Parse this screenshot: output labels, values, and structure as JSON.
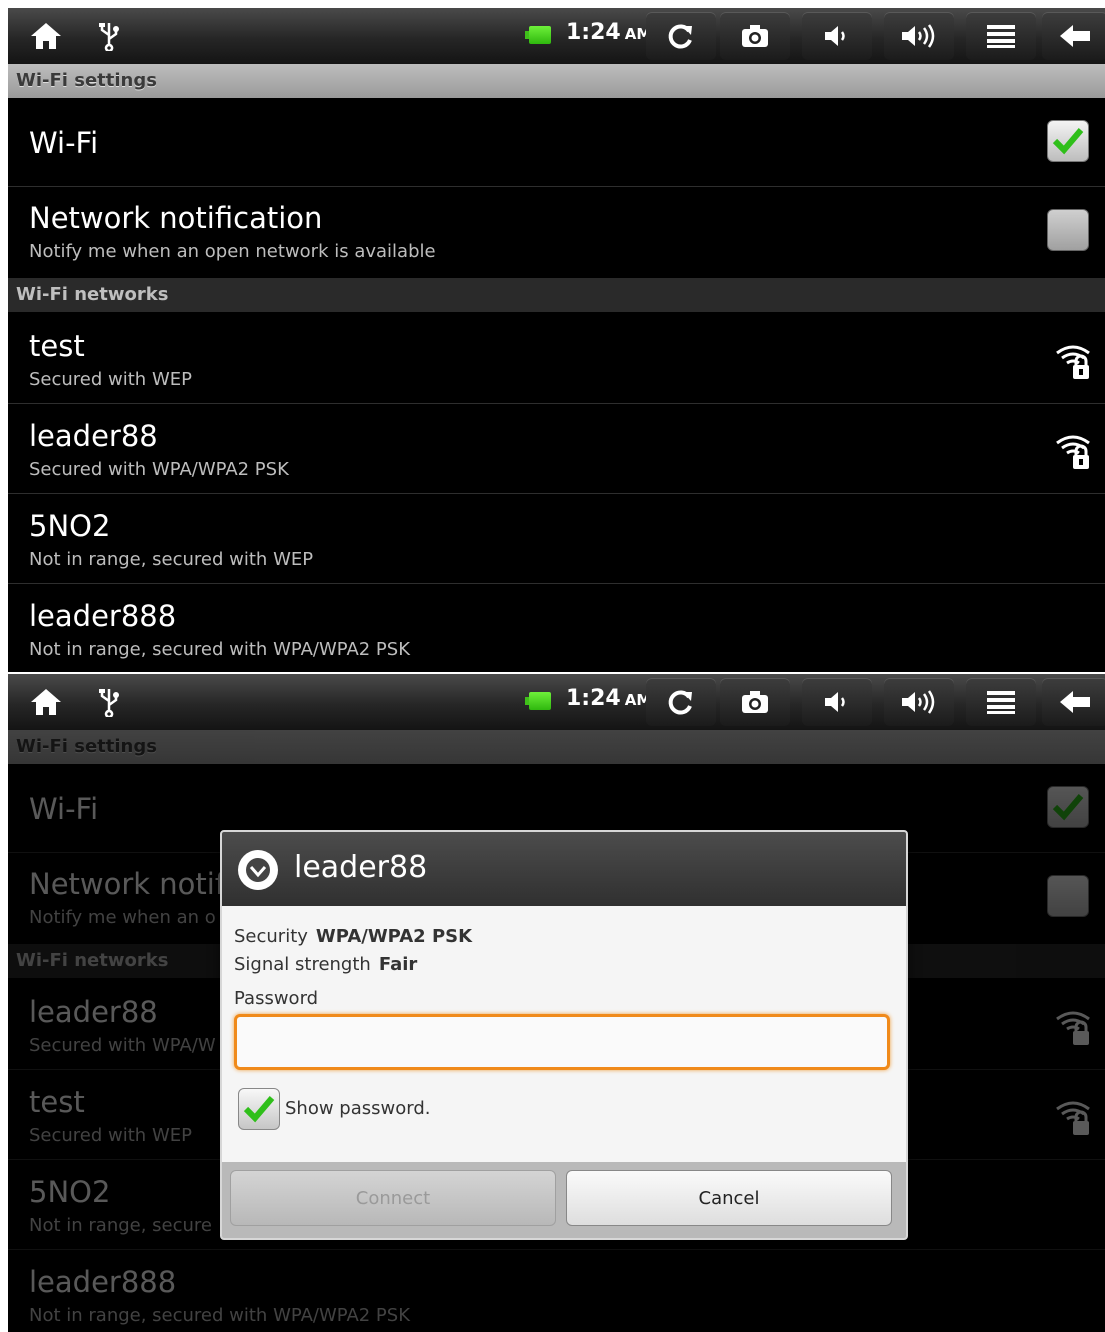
{
  "statusbar": {
    "time": "1:24",
    "ampm": "AM",
    "icons": [
      "home-icon",
      "usb-icon",
      "battery-icon",
      "refresh-icon",
      "camera-icon",
      "volume-down-icon",
      "volume-up-icon",
      "menu-icon",
      "back-icon"
    ]
  },
  "screen1": {
    "header": "Wi-Fi settings",
    "wifi": {
      "label": "Wi-Fi",
      "checked": true
    },
    "network_notification": {
      "title": "Network notification",
      "subtitle": "Notify me when an open network is available",
      "checked": false
    },
    "networks_header": "Wi-Fi networks",
    "networks": [
      {
        "name": "test",
        "status": "Secured with WEP",
        "icon": "wifi-locked-icon"
      },
      {
        "name": "leader88",
        "status": "Secured with WPA/WPA2 PSK",
        "icon": "wifi-locked-icon"
      },
      {
        "name": "5NO2",
        "status": "Not in range, secured with WEP"
      },
      {
        "name": "leader888",
        "status": "Not in range, secured with WPA/WPA2 PSK"
      }
    ]
  },
  "screen2": {
    "header": "Wi-Fi settings",
    "wifi": {
      "label": "Wi-Fi"
    },
    "network_notification": {
      "title": "Network notif",
      "subtitle": "Notify me when an o"
    },
    "networks_header": "Wi-Fi networks",
    "networks": [
      {
        "name": "leader88",
        "status": "Secured with WPA/W"
      },
      {
        "name": "test",
        "status": "Secured with WEP"
      },
      {
        "name": "5NO2",
        "status": "Not in range, secure"
      },
      {
        "name": "leader888",
        "status": "Not in range, secured with WPA/WPA2 PSK"
      }
    ],
    "dialog": {
      "title": "leader88",
      "security_label": "Security",
      "security_value": "WPA/WPA2 PSK",
      "signal_label": "Signal strength",
      "signal_value": "Fair",
      "password_label": "Password",
      "password_value": "",
      "show_password_label": "Show password.",
      "show_password_checked": true,
      "connect_label": "Connect",
      "cancel_label": "Cancel"
    }
  },
  "colors": {
    "accent_check": "#2fbf1a",
    "input_focus": "#f08a1a"
  }
}
